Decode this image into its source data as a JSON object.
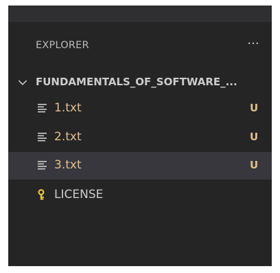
{
  "explorer": {
    "title": "EXPLORER",
    "more_label": "···"
  },
  "section": {
    "title": "FUNDAMENTALS_OF_SOFTWARE_..."
  },
  "files": [
    {
      "name": "1.txt",
      "status": "U",
      "icon": "text-file-icon"
    },
    {
      "name": "2.txt",
      "status": "U",
      "icon": "text-file-icon"
    },
    {
      "name": "3.txt",
      "status": "U",
      "icon": "text-file-icon"
    },
    {
      "name": "LICENSE",
      "status": "",
      "icon": "license-key-icon"
    }
  ],
  "colors": {
    "sidebar_bg": "#252526",
    "selected_row_bg": "#37373d",
    "untracked_text": "#e2c08d",
    "license_icon": "#e8c547"
  }
}
